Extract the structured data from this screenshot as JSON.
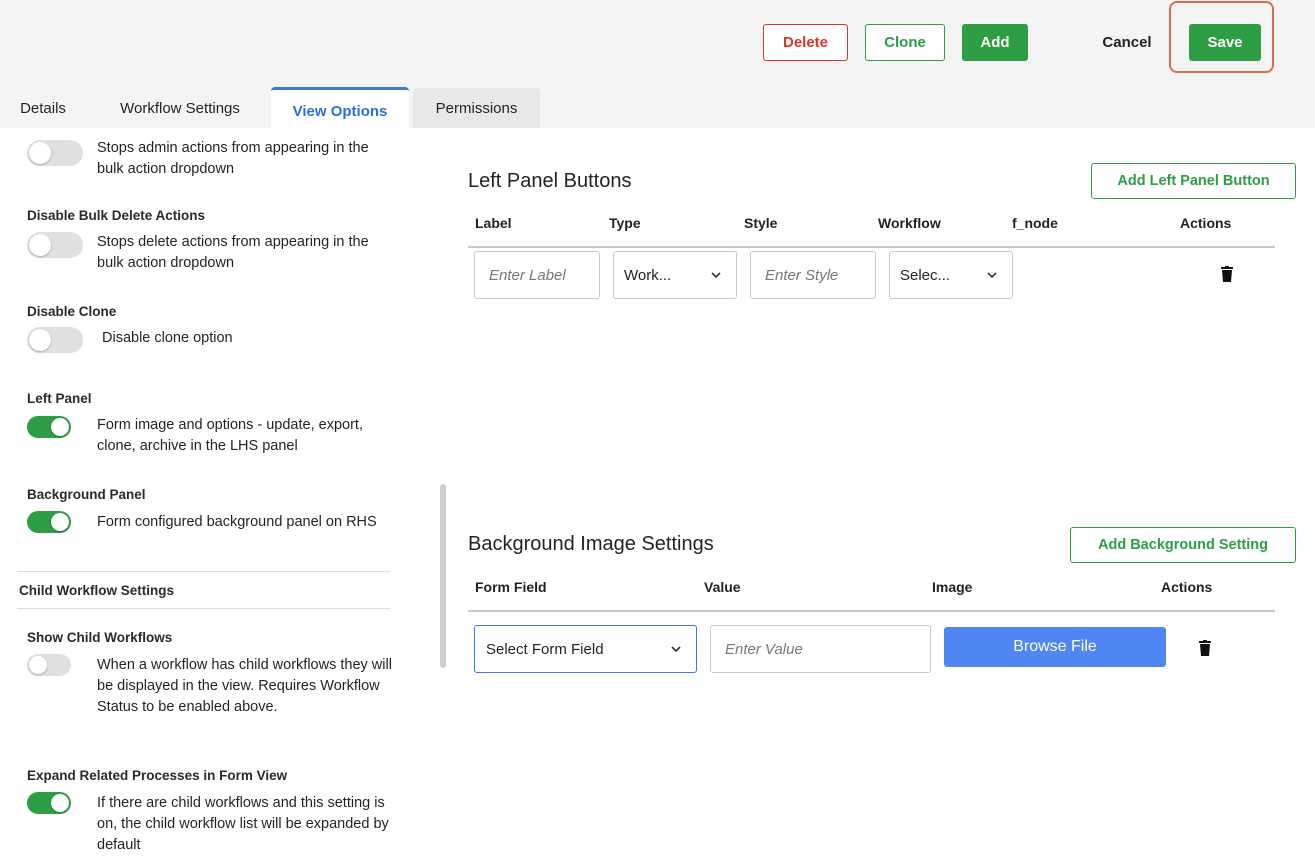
{
  "toolbar": {
    "delete_label": "Delete",
    "clone_label": "Clone",
    "add_label": "Add",
    "cancel_label": "Cancel",
    "save_label": "Save"
  },
  "tabs": [
    {
      "label": "Details"
    },
    {
      "label": "Workflow Settings"
    },
    {
      "label": "View Options"
    },
    {
      "label": "Permissions"
    }
  ],
  "left": {
    "bulk_admin_desc": "Stops admin actions from appearing in the bulk action dropdown",
    "bulk_delete_title": "Disable Bulk Delete Actions",
    "bulk_delete_desc": "Stops delete actions from appearing in the bulk action dropdown",
    "clone_title": "Disable Clone",
    "clone_desc": "Disable clone option",
    "left_panel_title": "Left Panel",
    "left_panel_desc": "Form image and options - update, export, clone, archive in the LHS panel",
    "bg_panel_title": "Background Panel",
    "bg_panel_desc": "Form configured background panel on RHS",
    "child_section": "Child Workflow Settings",
    "show_child_title": "Show Child Workflows",
    "show_child_desc": "When a workflow has child workflows they will be displayed in the view. Requires Workflow Status to be enabled above.",
    "expand_title": "Expand Related Processes in Form View",
    "expand_desc": "If there are child workflows and this setting is on, the child workflow list will be expanded by default"
  },
  "left_panel_buttons": {
    "title": "Left Panel Buttons",
    "add_button": "Add Left Panel Button",
    "columns": [
      "Label",
      "Type",
      "Style",
      "Workflow",
      "f_node",
      "Actions"
    ],
    "row": {
      "label_placeholder": "Enter Label",
      "type_value": "Work...",
      "style_placeholder": "Enter Style",
      "workflow_value": "Selec..."
    }
  },
  "background_image": {
    "title": "Background Image Settings",
    "add_button": "Add Background Setting",
    "columns": [
      "Form Field",
      "Value",
      "Image",
      "Actions"
    ],
    "row": {
      "form_field_value": "Select Form Field",
      "value_placeholder": "Enter Value",
      "browse_label": "Browse File"
    }
  },
  "colors": {
    "green": "#2e9e44",
    "red": "#d6362b",
    "blue": "#4f86f2",
    "tab_active": "#2a6fdb"
  }
}
